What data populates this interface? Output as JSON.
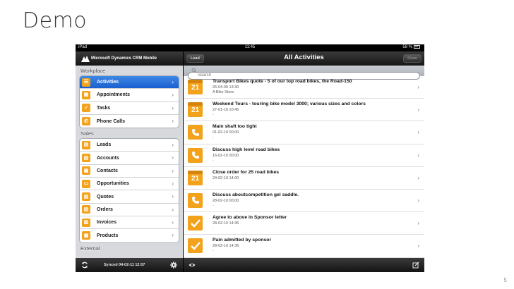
{
  "slide": {
    "title": "Demo",
    "number": "5"
  },
  "status_bar": {
    "left": "iPad",
    "time": "11:45",
    "battery": "58 %"
  },
  "left_pane": {
    "app_title": "Microsoft Dynamics CRM Mobile",
    "sections": [
      {
        "title": "Workplace",
        "items": [
          {
            "label": "Activities",
            "icon": "list-icon",
            "active": true
          },
          {
            "label": "Appointments",
            "icon": "calendar-icon"
          },
          {
            "label": "Tasks",
            "icon": "checkmark-icon"
          },
          {
            "label": "Phone Calls",
            "icon": "phone-icon"
          }
        ]
      },
      {
        "title": "Sales",
        "items": [
          {
            "label": "Leads",
            "icon": "lead-icon"
          },
          {
            "label": "Accounts",
            "icon": "account-icon"
          },
          {
            "label": "Contacts",
            "icon": "contact-icon"
          },
          {
            "label": "Opportunities",
            "icon": "opportunity-icon"
          },
          {
            "label": "Quotes",
            "icon": "quote-icon"
          },
          {
            "label": "Orders",
            "icon": "order-icon"
          },
          {
            "label": "Invoices",
            "icon": "invoice-icon"
          },
          {
            "label": "Products",
            "icon": "product-icon"
          }
        ]
      },
      {
        "title": "External",
        "items": []
      }
    ],
    "footer": {
      "sync_text": "Synced 04-02-11 12:07"
    }
  },
  "right_pane": {
    "nav_left_button": "Lead",
    "title": "All Activities",
    "nav_right_button": "Done",
    "search_placeholder": "Search",
    "activities": [
      {
        "type": "appointment",
        "title": "Transport Bikes quote - 5 of our top road bikes, the Road-150",
        "date": "26-04-09 13:30",
        "sub": "A Bike Store",
        "sub_orange": false
      },
      {
        "type": "appointment",
        "title": "Weekend Tours - touring bike model 3000; various sizes and colors",
        "date": "27-01-10 10:45",
        "sub": "-",
        "sub_orange": true
      },
      {
        "type": "phone",
        "title": "Main shaft too tight",
        "date": "01-02-10 00:00",
        "sub": "-",
        "sub_orange": true
      },
      {
        "type": "phone",
        "title": "Discuss high level road bikes",
        "date": "16-02-10 00:00",
        "sub": "-",
        "sub_orange": true
      },
      {
        "type": "appointment",
        "title": "Close order for 25 road bikes",
        "date": "24-02-10 14:00",
        "sub": "-",
        "sub_orange": true
      },
      {
        "type": "phone",
        "title": "Discuss aboutcompetition gel saddle.",
        "date": "28-02-10 00:00",
        "sub": "-",
        "sub_orange": true
      },
      {
        "type": "task",
        "title": "Agree to above in Sponsor letter",
        "date": "28-02-10 14:36",
        "sub": "-",
        "sub_orange": true
      },
      {
        "type": "task",
        "title": "Pain admitted by sponsor",
        "date": "28-02-10 14:36",
        "sub": "-",
        "sub_orange": true
      }
    ]
  },
  "colors": {
    "accent_orange": "#f3a21b",
    "selection_blue": "#2a6fdb"
  }
}
